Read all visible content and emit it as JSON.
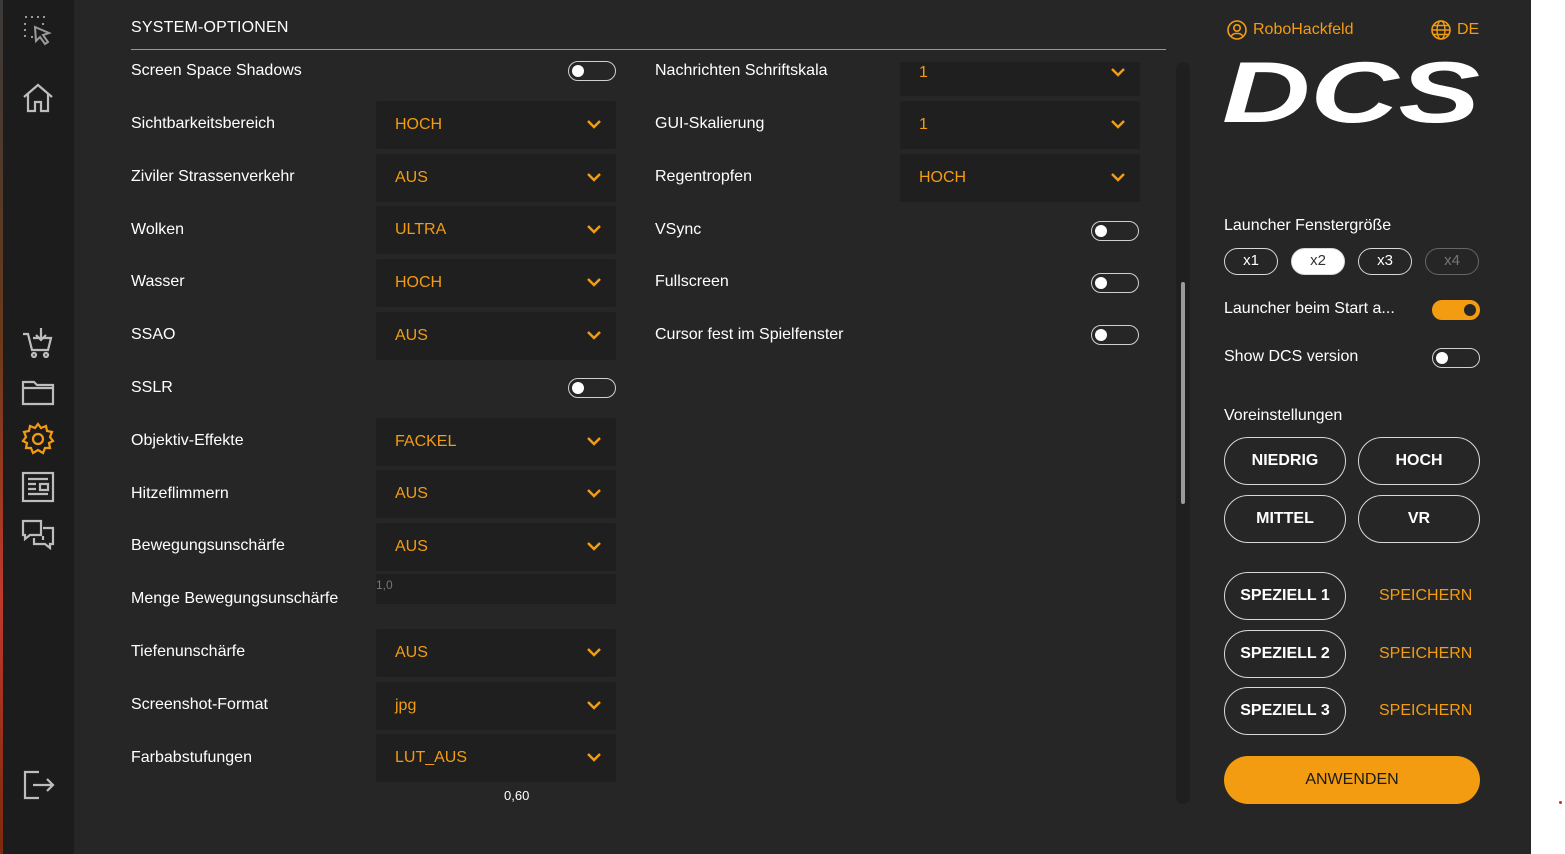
{
  "section": {
    "title": "SYSTEM-OPTIONEN"
  },
  "colors": {
    "accent": "#f39c12",
    "background": "#262626",
    "sidebar": "#1c1c1c",
    "field": "#1f1f1f"
  },
  "sidebar": {
    "icons": [
      "select-area-icon",
      "home-icon",
      "shop-cart-icon",
      "folder-icon",
      "settings-gear-icon",
      "news-icon",
      "chat-icon",
      "logout-icon"
    ],
    "active": "settings-gear-icon"
  },
  "left_column": [
    {
      "label": "Screen Space Shadows",
      "type": "toggle",
      "on": false
    },
    {
      "label": "Sichtbarkeitsbereich",
      "type": "select",
      "value": "HOCH"
    },
    {
      "label": "Ziviler Strassenverkehr",
      "type": "select",
      "value": "AUS"
    },
    {
      "label": "Wolken",
      "type": "select",
      "value": "ULTRA"
    },
    {
      "label": "Wasser",
      "type": "select",
      "value": "HOCH"
    },
    {
      "label": "SSAO",
      "type": "select",
      "value": "AUS"
    },
    {
      "label": "SSLR",
      "type": "toggle",
      "on": false
    },
    {
      "label": "Objektiv-Effekte",
      "type": "select",
      "value": "FACKEL"
    },
    {
      "label": "Hitzeflimmern",
      "type": "select",
      "value": "AUS"
    },
    {
      "label": "Bewegungsunschärfe",
      "type": "select",
      "value": "AUS"
    },
    {
      "label": "Menge Bewegungsunschärfe",
      "type": "slider",
      "value": "1,0"
    },
    {
      "label": "Tiefenunschärfe",
      "type": "select",
      "value": "AUS"
    },
    {
      "label": "Screenshot-Format",
      "type": "select",
      "value": "jpg"
    },
    {
      "label": "Farbabstufungen",
      "type": "select",
      "value": "LUT_AUS"
    },
    {
      "label": "",
      "type": "slider",
      "value": "0,60"
    }
  ],
  "right_column": [
    {
      "label": "Nachrichten Schriftskala",
      "type": "select",
      "value": "1"
    },
    {
      "label": "GUI-Skalierung",
      "type": "select",
      "value": "1"
    },
    {
      "label": "Regentropfen",
      "type": "select",
      "value": "HOCH"
    },
    {
      "label": "VSync",
      "type": "toggle",
      "on": false
    },
    {
      "label": "Fullscreen",
      "type": "toggle",
      "on": false
    },
    {
      "label": "Cursor fest im Spielfenster",
      "type": "toggle",
      "on": false
    }
  ],
  "panel": {
    "username": "RoboHackfeld",
    "language": "DE",
    "logo_text": "DCS",
    "window_size_label": "Launcher Fenstergröße",
    "window_sizes": [
      "x1",
      "x2",
      "x3",
      "x4"
    ],
    "window_size_selected": "x2",
    "window_size_disabled": "x4",
    "launcher_start_label": "Launcher beim Start a...",
    "launcher_start_on": true,
    "show_version_label": "Show DCS version",
    "show_version_on": false,
    "presets_label": "Voreinstellungen",
    "presets": [
      "NIEDRIG",
      "HOCH",
      "MITTEL",
      "VR"
    ],
    "custom_presets": [
      "SPEZIELL 1",
      "SPEZIELL 2",
      "SPEZIELL 3"
    ],
    "save_label": "SPEICHERN",
    "apply_label": "ANWENDEN"
  }
}
